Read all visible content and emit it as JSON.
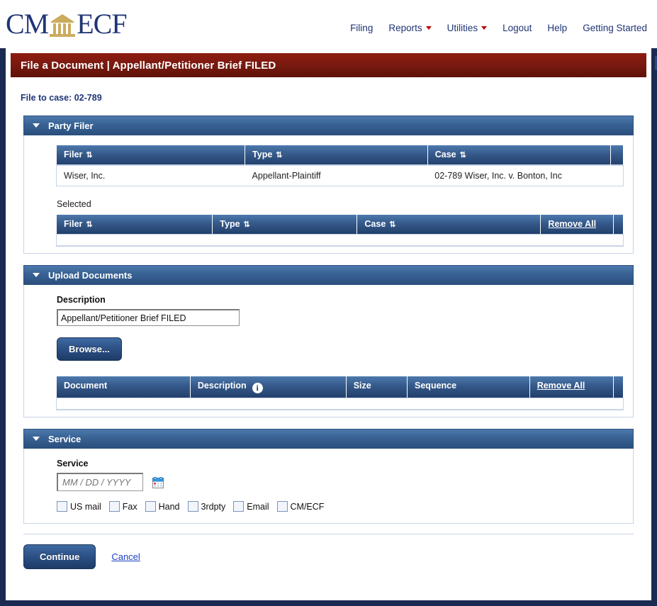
{
  "brand": {
    "text_left": "CM",
    "text_right": "ECF",
    "courthouse_icon": "courthouse-icon",
    "navy": "#1f3575",
    "gold": "#cbac5f"
  },
  "nav": {
    "items": [
      {
        "label": "Filing",
        "caret": false
      },
      {
        "label": "Reports",
        "caret": true
      },
      {
        "label": "Utilities",
        "caret": true
      },
      {
        "label": "Logout",
        "caret": false
      },
      {
        "label": "Help",
        "caret": false
      },
      {
        "label": "Getting Started",
        "caret": false
      }
    ]
  },
  "window": {
    "title": "File a Document | Appellant/Petitioner Brief FILED",
    "expand_icon": "expand-arrows-icon",
    "title_color": "#7b1a10"
  },
  "case": {
    "file_to_case_label": "File to case: 02-789"
  },
  "party_filer": {
    "header": "Party Filer",
    "collapse_icon": "caret-down-icon",
    "available": {
      "columns": [
        "Filer",
        "Type",
        "Case"
      ],
      "sort_icon": "sort-updown-icon",
      "rows": [
        {
          "filer": "Wiser, Inc.",
          "type": "Appellant-Plaintiff",
          "case": "02-789 Wiser, Inc. v. Bonton, Inc"
        }
      ]
    },
    "selected": {
      "label": "Selected",
      "columns": [
        "Filer",
        "Type",
        "Case"
      ],
      "remove_all": "Remove All",
      "rows": []
    }
  },
  "upload_documents": {
    "header": "Upload Documents",
    "collapse_icon": "caret-down-icon",
    "description_label": "Description",
    "description_value": "Appellant/Petitioner Brief FILED",
    "description_placeholder": "",
    "browse_label": "Browse...",
    "table": {
      "columns": [
        "Document",
        "Description",
        "Size",
        "Sequence"
      ],
      "info_icon": "info-icon",
      "remove_all": "Remove All",
      "rows": []
    }
  },
  "service": {
    "header": "Service",
    "collapse_icon": "caret-down-icon",
    "field_label": "Service",
    "date_value": "",
    "date_placeholder": "MM / DD / YYYY",
    "calendar_icon": "calendar-icon",
    "methods": [
      {
        "label": "US mail",
        "checked": false
      },
      {
        "label": "Fax",
        "checked": false
      },
      {
        "label": "Hand",
        "checked": false
      },
      {
        "label": "3rdpty",
        "checked": false
      },
      {
        "label": "Email",
        "checked": false
      },
      {
        "label": "CM/ECF",
        "checked": false
      }
    ]
  },
  "footer": {
    "continue_label": "Continue",
    "cancel_label": "Cancel"
  }
}
